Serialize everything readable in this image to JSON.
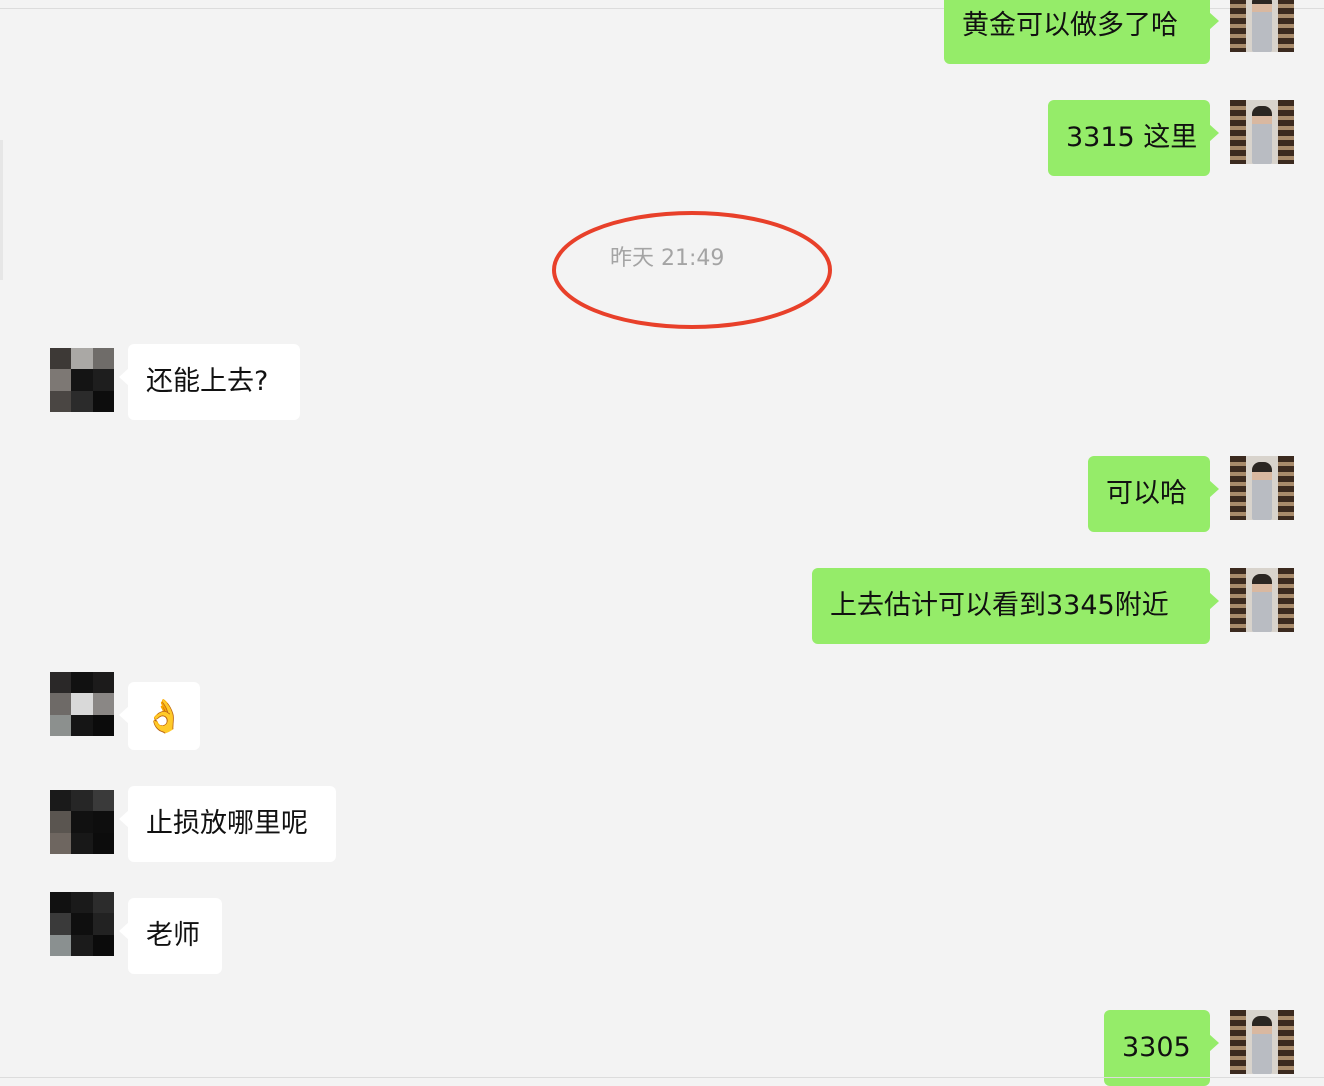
{
  "timestamp": "昨天 21:49",
  "annotation_color": "#e8402a",
  "messages": [
    {
      "side": "out",
      "text": "黄金可以做多了哈"
    },
    {
      "side": "out",
      "text": "3315 这里"
    },
    {
      "side": "in",
      "text": "还能上去?"
    },
    {
      "side": "out",
      "text": "可以哈"
    },
    {
      "side": "out",
      "text": "上去估计可以看到3345附近"
    },
    {
      "side": "in",
      "text": "👌"
    },
    {
      "side": "in",
      "text": "止损放哪里呢"
    },
    {
      "side": "in",
      "text": "老师"
    },
    {
      "side": "out",
      "text": "3305"
    }
  ],
  "avatar_icons": {
    "teacher": "teacher-avatar",
    "user": "pixelated-user-avatar"
  }
}
